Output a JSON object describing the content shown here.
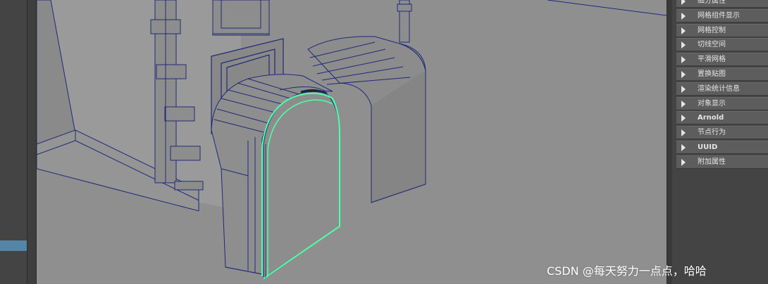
{
  "colors": {
    "viewport_bg": "#8f8f8f",
    "wireframe": "#1e2a78",
    "selection": "#4dffa6",
    "panel_bg": "#444444",
    "section_bg": "#5d5d5d",
    "accent": "#5285a6"
  },
  "attribute_sections": [
    {
      "label": "细分属性",
      "bold": false
    },
    {
      "label": "网格组件显示",
      "bold": false
    },
    {
      "label": "网格控制",
      "bold": false
    },
    {
      "label": "切线空间",
      "bold": false
    },
    {
      "label": "平滑网格",
      "bold": false
    },
    {
      "label": "置换贴图",
      "bold": false
    },
    {
      "label": "渲染统计信息",
      "bold": false
    },
    {
      "label": "对象显示",
      "bold": false
    },
    {
      "label": "Arnold",
      "bold": true
    },
    {
      "label": "节点行为",
      "bold": false
    },
    {
      "label": "UUID",
      "bold": true
    },
    {
      "label": "附加属性",
      "bold": false
    }
  ],
  "icons": {
    "section_arrow": "triangle-right-icon"
  },
  "watermark": "CSDN @每天努力一点点，哈哈"
}
